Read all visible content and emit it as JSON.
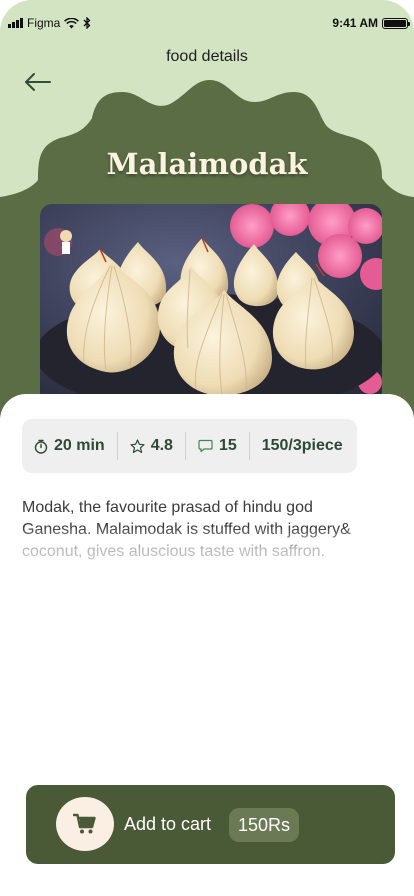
{
  "status_bar": {
    "carrier": "Figma",
    "time": "9:41 AM",
    "battery_level": 1.0
  },
  "header": {
    "title": "food details",
    "back_icon": "arrow-left-icon"
  },
  "food": {
    "name": "Malaimodak",
    "image_subject": "plate of malai modak sweets"
  },
  "stats": [
    {
      "icon": "timer-icon",
      "value": "20 min"
    },
    {
      "icon": "star-icon",
      "value": "4.8"
    },
    {
      "icon": "comment-icon",
      "value": "15"
    },
    {
      "icon": "",
      "value": "150/3piece"
    }
  ],
  "description": "Modak, the favourite prasad of hindu god Ganesha. Malaimodak is stuffed with jaggery& coconut, gives aluscious taste with saffron.",
  "cart": {
    "icon": "cart-icon",
    "label": "Add to cart",
    "price": "150Rs"
  },
  "colors": {
    "light_green": "#d3e4c2",
    "dark_green": "#5b6d45",
    "cart_bg": "#4b5a36",
    "price_badge": "#6b7a55",
    "title_cream": "#fbf2e0"
  }
}
